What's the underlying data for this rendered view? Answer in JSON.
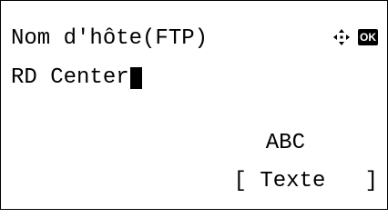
{
  "screen": {
    "title": "Nom d'hôte(FTP)",
    "input_value": "RD Center",
    "input_mode": "ABC",
    "softkey": {
      "bracket_left": "[",
      "label": "Texte",
      "bracket_right": "]"
    },
    "icons": {
      "nav": "navigation-cross-icon",
      "ok": "OK"
    }
  }
}
